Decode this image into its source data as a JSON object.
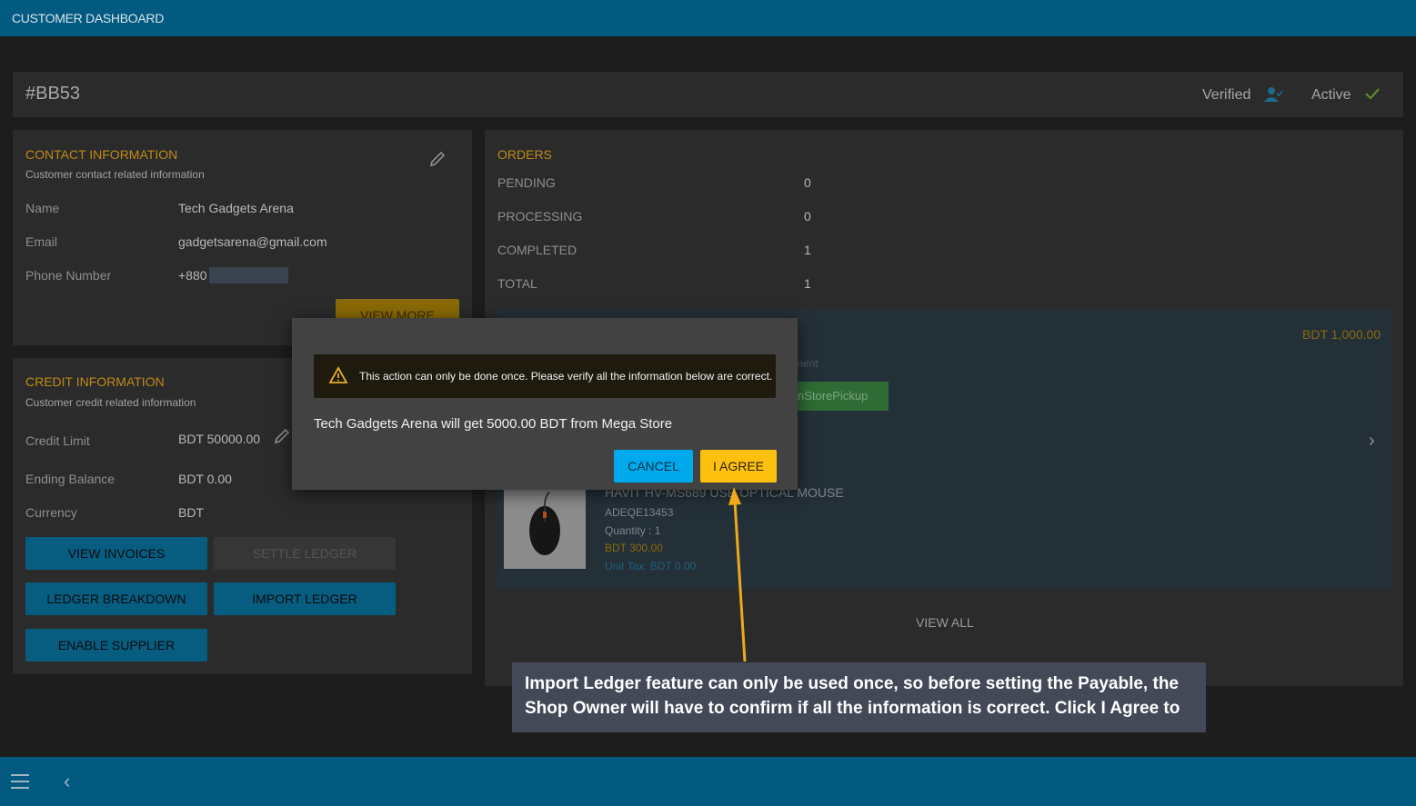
{
  "header": {
    "title": "CUSTOMER DASHBOARD"
  },
  "customer": {
    "id": "#BB53",
    "verified_label": "Verified",
    "active_label": "Active"
  },
  "contact": {
    "title": "CONTACT INFORMATION",
    "subtitle": "Customer contact related information",
    "name_label": "Name",
    "name_value": "Tech Gadgets Arena",
    "email_label": "Email",
    "email_value": "gadgetsarena@gmail.com",
    "phone_label": "Phone Number",
    "phone_prefix": "+880",
    "view_more": "VIEW MORE"
  },
  "credit": {
    "title": "CREDIT INFORMATION",
    "subtitle": "Customer credit related information",
    "limit_label": "Credit Limit",
    "limit_value": "BDT 50000.00",
    "ending_label": "Ending Balance",
    "ending_value": "BDT 0.00",
    "currency_label": "Currency",
    "currency_value": "BDT",
    "buttons": {
      "view_invoices": "VIEW INVOICES",
      "settle_ledger": "SETTLE LEDGER",
      "ledger_breakdown": "LEDGER BREAKDOWN",
      "import_ledger": "IMPORT LEDGER",
      "enable_supplier": "ENABLE SUPPLIER"
    }
  },
  "orders": {
    "title": "ORDERS",
    "rows": [
      {
        "label": "PENDING",
        "value": "0"
      },
      {
        "label": "PROCESSING",
        "value": "0"
      },
      {
        "label": "COMPLETED",
        "value": "1"
      },
      {
        "label": "TOTAL",
        "value": "1"
      }
    ],
    "order_total": "BDT 1,000.00",
    "payment_fragment": "ment",
    "delivery_fragment": "nStorePickup",
    "product": {
      "name": "HAVIT HV-MS689 USB OPTICAL MOUSE",
      "sku": "ADEQE13453",
      "quantity": "Quantity : 1",
      "price": "BDT 300.00",
      "unit_tax": "Unit Tax: BDT 0.00"
    },
    "view_all": "VIEW ALL"
  },
  "modal": {
    "warning": "This action can only be done once. Please verify all the information below are correct.",
    "message": "Tech Gadgets Arena will get 5000.00 BDT from Mega Store",
    "cancel": "CANCEL",
    "agree": "I AGREE"
  },
  "callout": {
    "line1": "Import Ledger feature can only be used once, so before setting the Payable, the",
    "line2": "Shop Owner will have to confirm if all the information is correct. Click I Agree to"
  },
  "colors": {
    "topbar": "#025a80",
    "accent_yellow": "#fec00f",
    "accent_blue": "#00a9ec",
    "orange_title": "#c08a16"
  }
}
